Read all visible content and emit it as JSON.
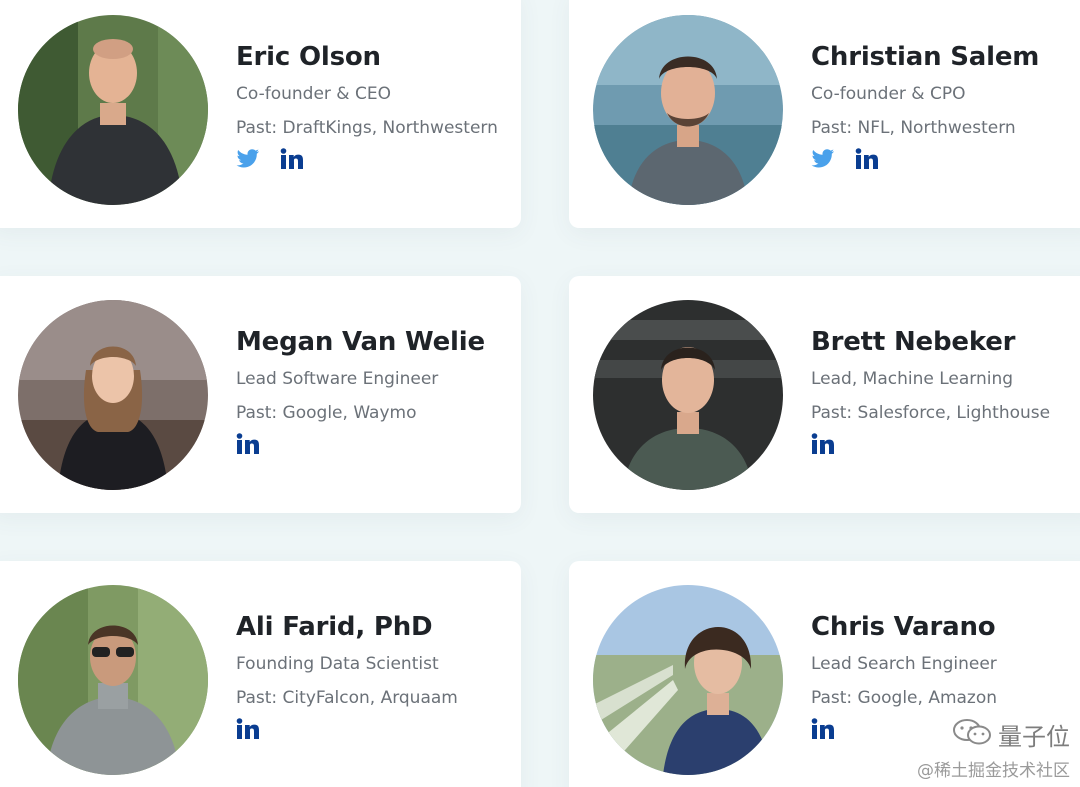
{
  "colors": {
    "background": "#eef6f7",
    "card": "#ffffff",
    "name": "#1f2328",
    "subtext": "#6b7178",
    "twitter": "#4aa1eb",
    "linkedin": "#0a3d91"
  },
  "team": [
    {
      "name": "Eric Olson",
      "role": "Co-founder & CEO",
      "past": "Past: DraftKings, Northwestern",
      "socials": [
        "twitter-icon",
        "linkedin-icon"
      ]
    },
    {
      "name": "Christian Salem",
      "role": "Co-founder & CPO",
      "past": "Past: NFL, Northwestern",
      "socials": [
        "twitter-icon",
        "linkedin-icon"
      ]
    },
    {
      "name": "Megan Van Welie",
      "role": "Lead Software Engineer",
      "past": "Past: Google, Waymo",
      "socials": [
        "linkedin-icon"
      ]
    },
    {
      "name": "Brett Nebeker",
      "role": "Lead, Machine Learning",
      "past": "Past: Salesforce, Lighthouse",
      "socials": [
        "linkedin-icon"
      ]
    },
    {
      "name": "Ali Farid, PhD",
      "role": "Founding Data Scientist",
      "past": "Past: CityFalcon, Arquaam",
      "socials": [
        "linkedin-icon"
      ]
    },
    {
      "name": "Chris Varano",
      "role": "Lead Search Engineer",
      "past": "Past: Google, Amazon",
      "socials": [
        "linkedin-icon"
      ]
    }
  ],
  "watermark": {
    "brand": "量子位",
    "source": "@稀土掘金技术社区"
  }
}
